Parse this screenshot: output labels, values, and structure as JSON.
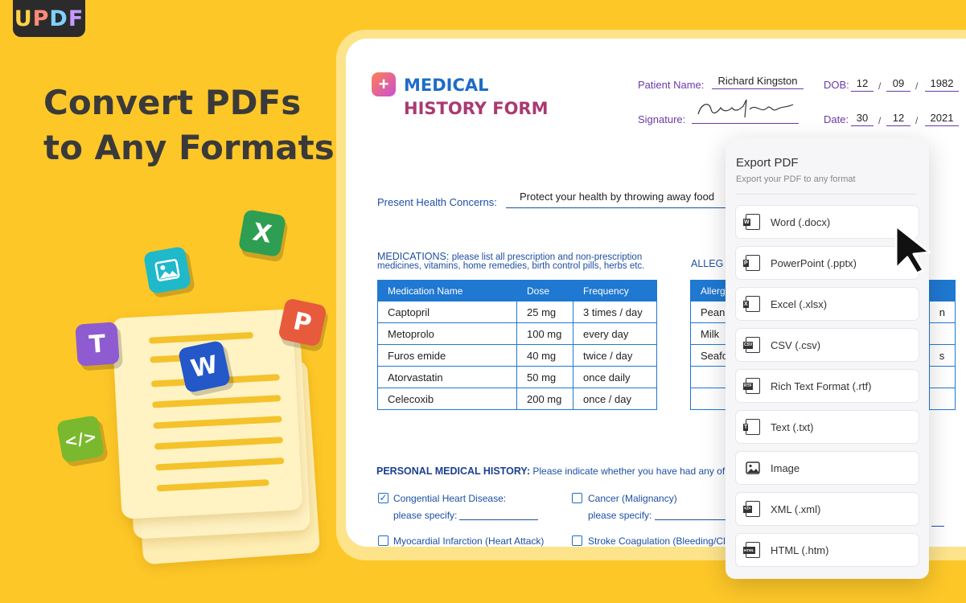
{
  "brand": {
    "logo_letters": [
      "U",
      "P",
      "D",
      "F"
    ]
  },
  "headline": {
    "line1": "Convert PDFs",
    "line2": "to Any Formats"
  },
  "illustration": {
    "tiles": {
      "excel": "X",
      "image": "",
      "powerpoint": "P",
      "text": "T",
      "word": "W",
      "code": "</>"
    }
  },
  "form": {
    "title_line1": "MEDICAL",
    "title_line2": "HISTORY FORM",
    "patient_name_label": "Patient Name:",
    "patient_name": "Richard Kingston",
    "dob_label": "DOB:",
    "dob": {
      "day": "12",
      "month": "09",
      "year": "1982"
    },
    "signature_label": "Signature:",
    "date_label": "Date:",
    "date": {
      "day": "30",
      "month": "12",
      "year": "2021"
    },
    "health_concerns_label": "Present Health Concerns:",
    "health_concerns": "Protect your health by throwing away food",
    "medications_heading": "MEDICATIONS:",
    "medications_note1": "please list all prescription and non-prescription",
    "medications_note2": "medicines, vitamins, home remedies, birth control pills, herbs etc.",
    "allergies_heading": "ALLEG",
    "med_columns": [
      "Medication Name",
      "Dose",
      "Frequency"
    ],
    "med_rows": [
      [
        "Captopril",
        "25 mg",
        "3 times / day"
      ],
      [
        "Metoprolo",
        "100 mg",
        "every day"
      ],
      [
        "Furos emide",
        "40 mg",
        "twice / day"
      ],
      [
        "Atorvastatin",
        "50 mg",
        "once daily"
      ],
      [
        "Celecoxib",
        "200 mg",
        "once / day"
      ]
    ],
    "allergy_header": "Allerg",
    "allergy_rows": [
      "Pean",
      "Milk",
      "Seafo",
      "",
      ""
    ],
    "allergy_right": [
      "n",
      "",
      "s",
      "",
      ""
    ],
    "history_heading": "PERSONAL MEDICAL HISTORY:",
    "history_note": "Please indicate whether you have had any of",
    "conditions": {
      "c1": "Congential Heart Disease:",
      "c1_specify": "please specify:",
      "c2": "Cancer (Malignancy)",
      "c2_specify": "please specify:",
      "c3": "Myocardial Infarction (Heart Attack)",
      "c4": "Stroke Coagulation (Bleeding/Cl"
    }
  },
  "export_panel": {
    "title": "Export PDF",
    "subtitle": "Export your PDF to any format",
    "options": [
      {
        "label": "Word (.docx)",
        "icon": "W"
      },
      {
        "label": "PowerPoint (.pptx)",
        "icon": "P"
      },
      {
        "label": "Excel (.xlsx)",
        "icon": "X"
      },
      {
        "label": "CSV (.csv)",
        "icon": "CSV"
      },
      {
        "label": "Rich Text Format (.rtf)",
        "icon": "RTF"
      },
      {
        "label": "Text (.txt)",
        "icon": "T"
      },
      {
        "label": "Image",
        "icon": "IMG"
      },
      {
        "label": "XML (.xml)",
        "icon": "</>"
      },
      {
        "label": "HTML (.htm)",
        "icon": "HTML"
      }
    ]
  },
  "colors": {
    "background": "#FDC728",
    "accent_blue": "#1f78d1",
    "accent_purple": "#6b3aa9",
    "title_magenta": "#a93a72"
  }
}
